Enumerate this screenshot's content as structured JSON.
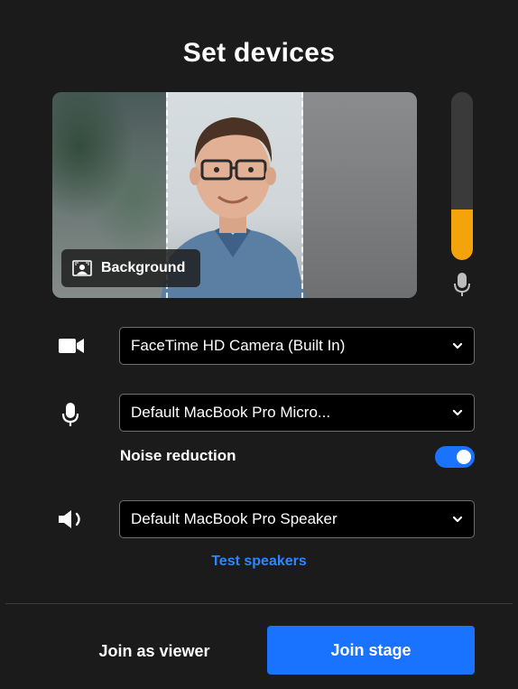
{
  "header": {
    "title": "Set devices"
  },
  "preview": {
    "background_button_label": "Background",
    "background_icon": "background-person-icon"
  },
  "mic_meter": {
    "level": 0.3,
    "color": "#f5a30a",
    "icon": "microphone-icon"
  },
  "camera": {
    "icon": "video-camera-icon",
    "selected": "FaceTime HD Camera (Built In)"
  },
  "microphone": {
    "icon": "microphone-icon",
    "selected": "Default MacBook Pro Micro..."
  },
  "noise_reduction": {
    "label": "Noise reduction",
    "enabled": true
  },
  "speaker": {
    "icon": "speaker-icon",
    "selected": "Default MacBook Pro Speaker"
  },
  "test_speakers_label": "Test speakers",
  "footer": {
    "viewer_label": "Join as viewer",
    "join_label": "Join stage"
  },
  "colors": {
    "accent": "#1a73ff",
    "background": "#1b1b1b",
    "meter": "#f5a30a"
  }
}
